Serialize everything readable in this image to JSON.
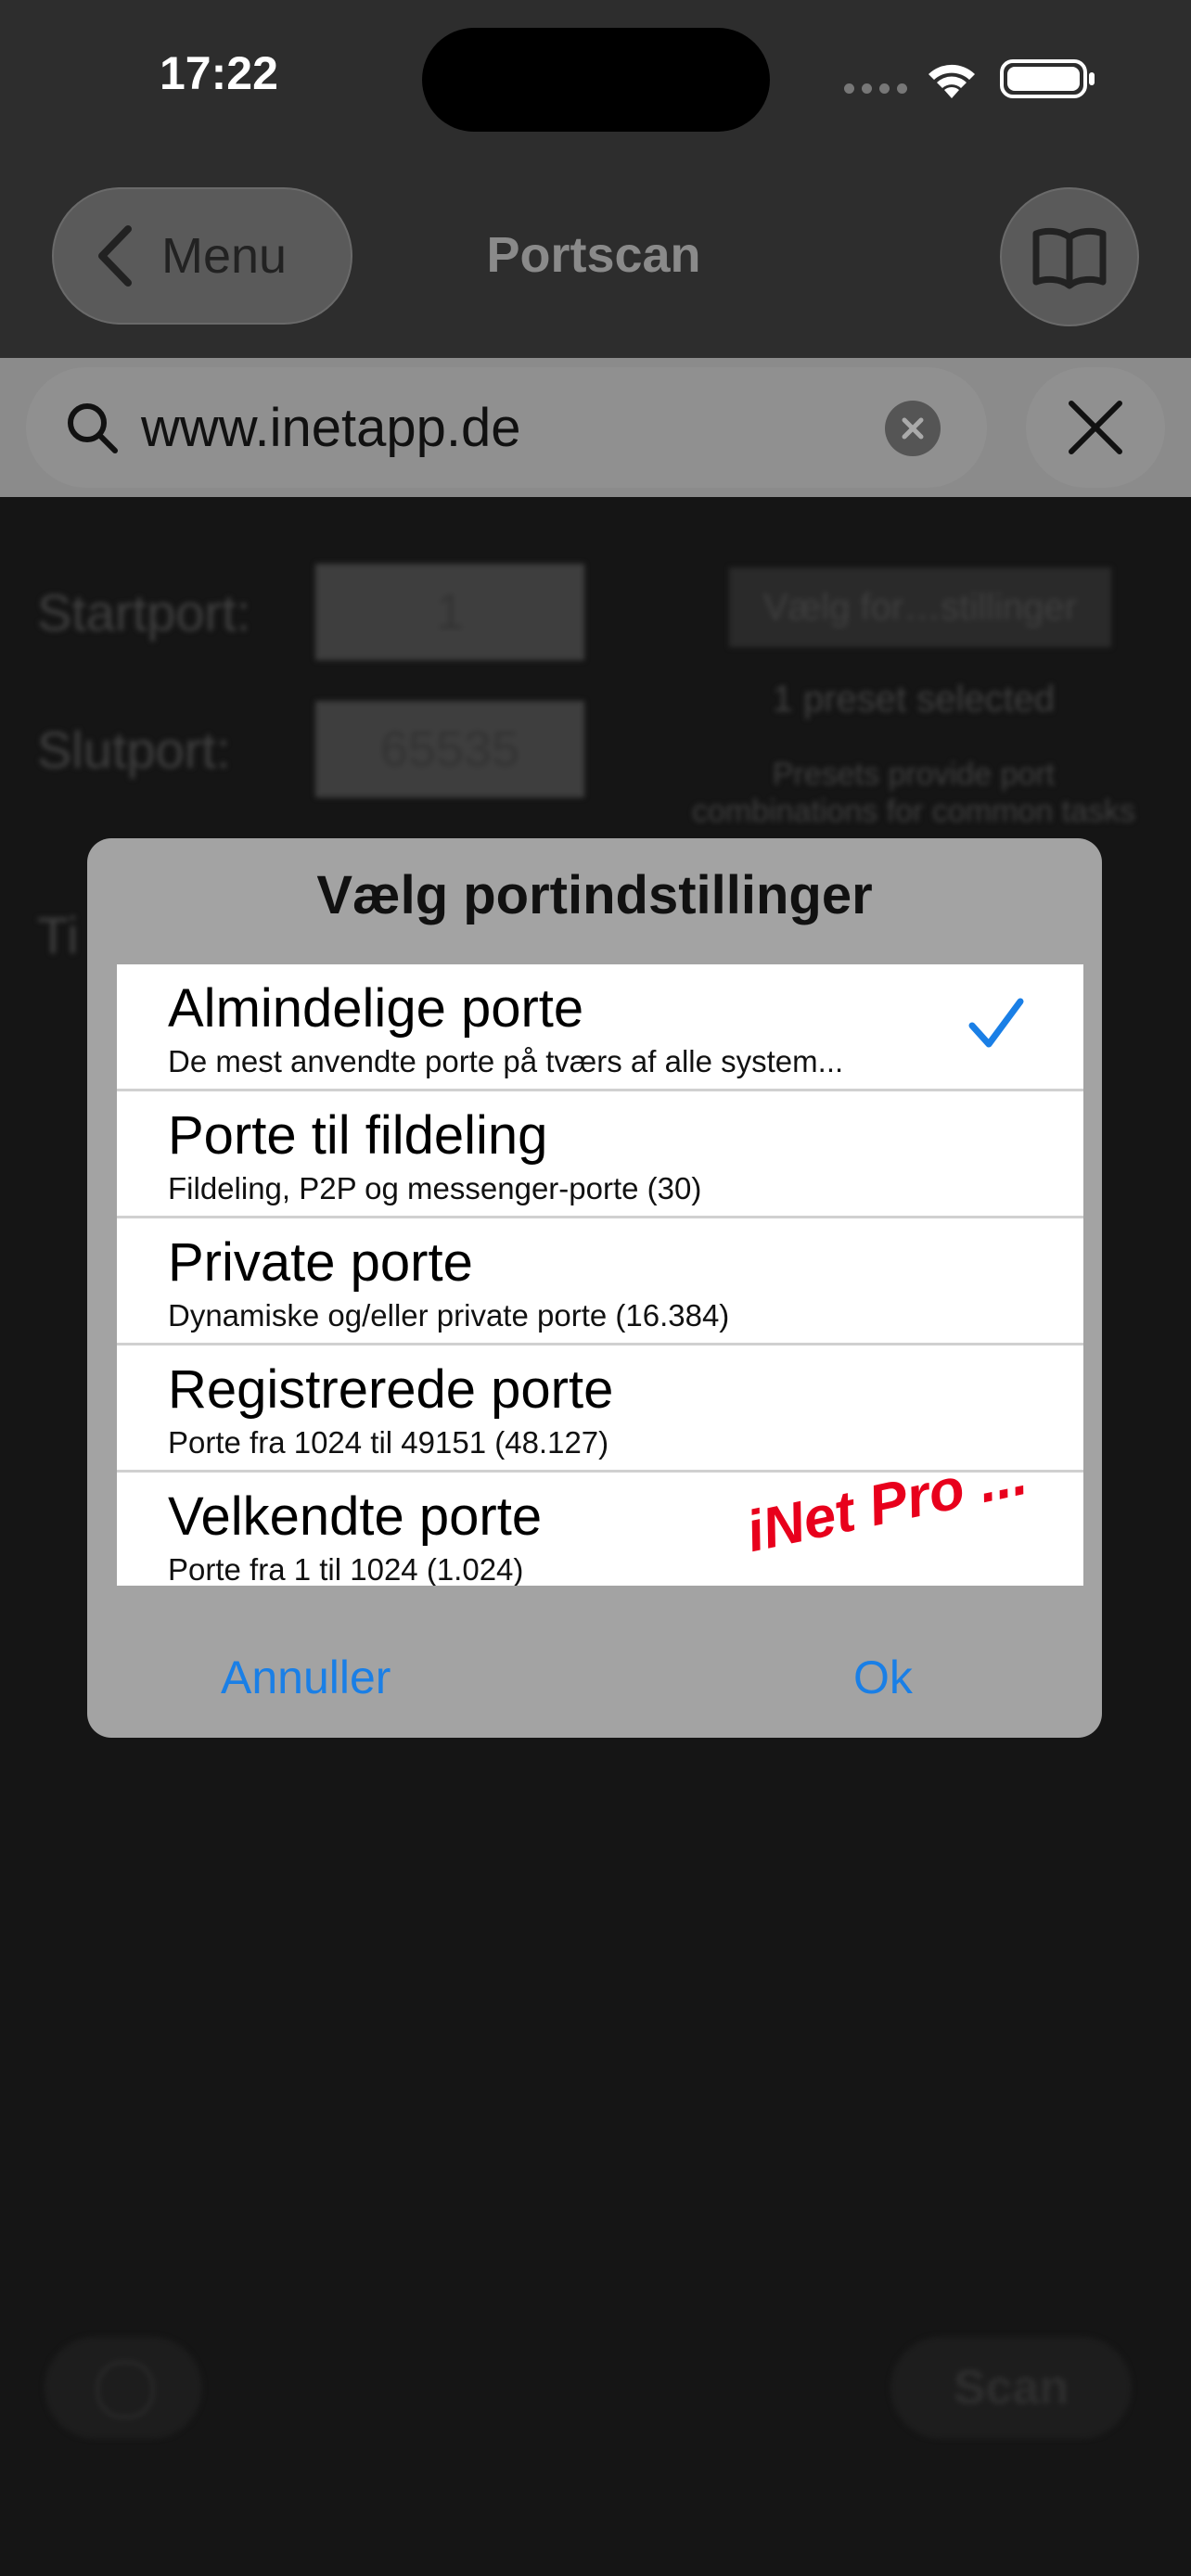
{
  "status_bar": {
    "time": "17:22"
  },
  "nav": {
    "back_label": "Menu",
    "title": "Portscan"
  },
  "search": {
    "value": "www.inetapp.de"
  },
  "form": {
    "startport_label": "Startport:",
    "startport_value": "1",
    "slutport_label": "Slutport:",
    "slutport_value": "65535",
    "preset_button": "Vælg for…stillinger",
    "preset_count": "1 preset selected",
    "preset_hint_line1": "Presets provide port",
    "preset_hint_line2": "combinations for common tasks",
    "partial_label": "Ti",
    "scan_label": "Scan"
  },
  "dialog": {
    "title": "Vælg portindstillinger",
    "items": [
      {
        "title": "Almindelige porte",
        "subtitle": "De mest anvendte porte på tværs af alle system...",
        "selected": true
      },
      {
        "title": "Porte til fildeling",
        "subtitle": "Fildeling, P2P og messenger-porte (30)",
        "selected": false
      },
      {
        "title": "Private porte",
        "subtitle": "Dynamiske og/eller private porte (16.384)",
        "selected": false
      },
      {
        "title": "Registrerede porte",
        "subtitle": "Porte fra 1024 til 49151 (48.127)",
        "selected": false
      },
      {
        "title": "Velkendte porte",
        "subtitle": "Porte fra 1 til 1024 (1.024)",
        "selected": false
      }
    ],
    "pro_badge": "iNet Pro ...",
    "cancel_label": "Annuller",
    "ok_label": "Ok"
  },
  "colors": {
    "accent": "#1a7fe6",
    "pro": "#e8001c"
  }
}
